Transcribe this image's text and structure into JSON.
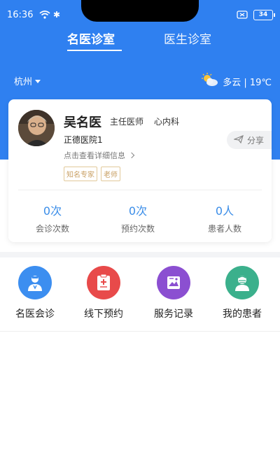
{
  "status_bar": {
    "time": "16:36",
    "battery": "34"
  },
  "tabs": [
    {
      "label": "名医诊室",
      "active": true
    },
    {
      "label": "医生诊室",
      "active": false
    }
  ],
  "city": "杭州",
  "weather": {
    "text": "多云 | 19℃",
    "icon": "partly-cloudy-icon"
  },
  "doctor": {
    "name": "吴名医",
    "title": "主任医师",
    "department": "心内科",
    "hospital": "正德医院1",
    "detail_link": "点击查看详细信息",
    "tags": [
      "知名专家",
      "老师"
    ],
    "share_label": "分享"
  },
  "stats": [
    {
      "value": "0次",
      "label": "会诊次数"
    },
    {
      "value": "0次",
      "label": "预约次数"
    },
    {
      "value": "0人",
      "label": "患者人数"
    }
  ],
  "menu": [
    {
      "label": "名医会诊",
      "icon": "doctor-icon",
      "color": "#3c8ef0"
    },
    {
      "label": "线下预约",
      "icon": "clipboard-plus-icon",
      "color": "#e84a4a"
    },
    {
      "label": "服务记录",
      "icon": "record-image-icon",
      "color": "#8b4fd1"
    },
    {
      "label": "我的患者",
      "icon": "patient-icon",
      "color": "#3bb08c"
    }
  ],
  "colors": {
    "primary": "#2f80f0",
    "stat_value": "#3a8de8",
    "tag": "#c9a064"
  }
}
